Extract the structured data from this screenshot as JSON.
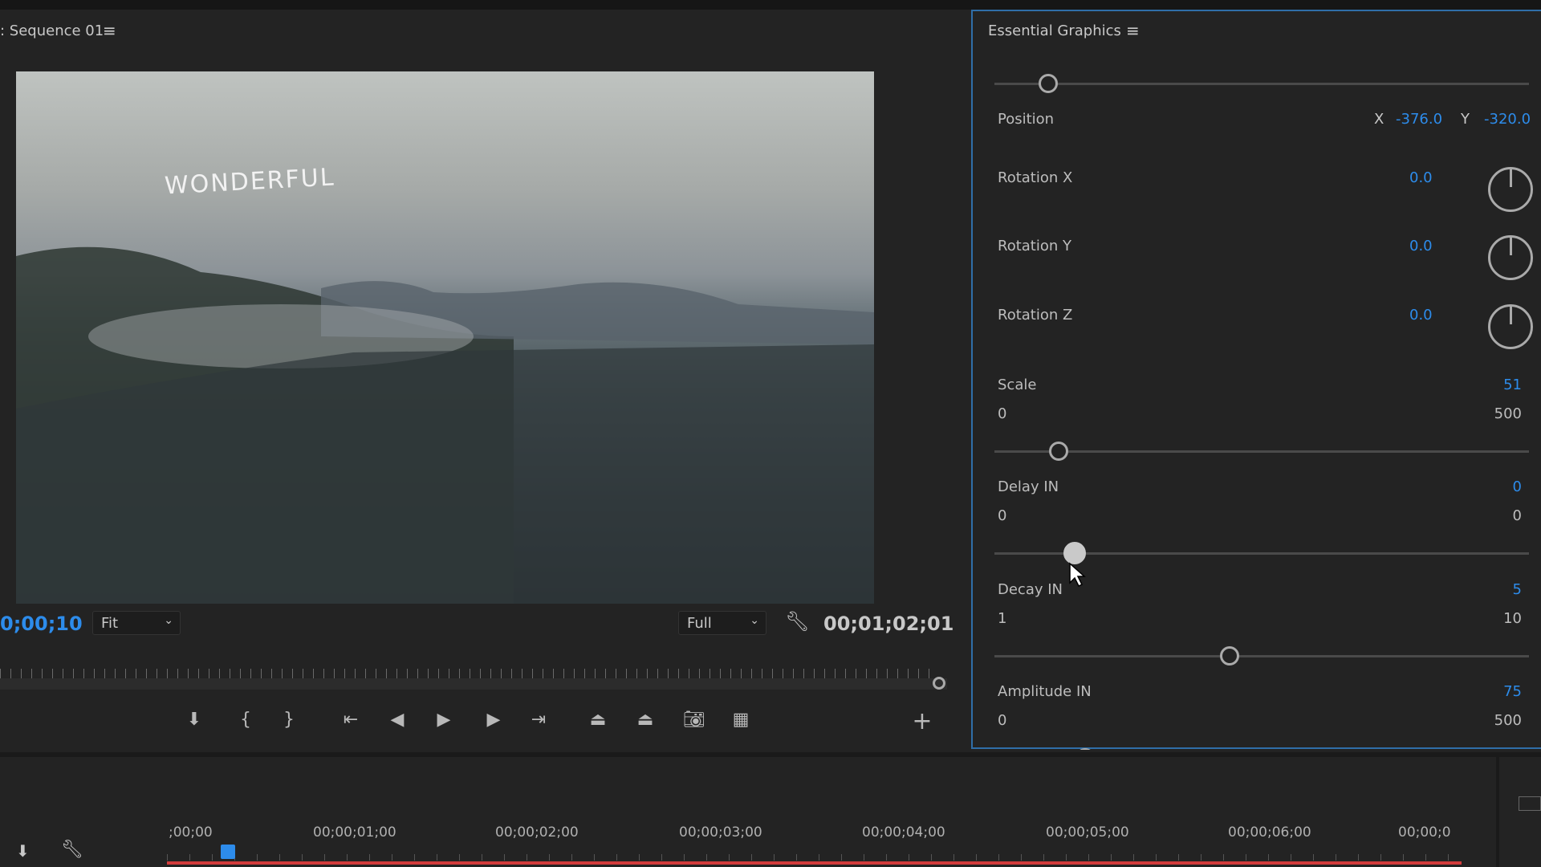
{
  "program": {
    "title": ": Sequence 01",
    "menu_icon": "hamburger-icon",
    "current_timecode": "0;00;10",
    "zoom_select": "Fit",
    "quality_select": "Full",
    "duration": "00;01;02;01",
    "overlay_text": "WONDERFUL"
  },
  "controls": [
    "marker-icon",
    "mark-in-icon",
    "mark-out-icon",
    "go-to-in-icon",
    "step-back-icon",
    "play-icon",
    "step-forward-icon",
    "go-to-out-icon",
    "lift-icon",
    "extract-icon",
    "export-frame-icon",
    "compare-view-icon",
    "add-button-icon"
  ],
  "essential_graphics": {
    "title": "Essential Graphics",
    "top_slider_fraction": 0.1,
    "position": {
      "label": "Position",
      "x_label": "X",
      "x": "-376.0",
      "y_label": "Y",
      "y": "-320.0"
    },
    "rotations": [
      {
        "label": "Rotation X",
        "value": "0.0"
      },
      {
        "label": "Rotation Y",
        "value": "0.0"
      },
      {
        "label": "Rotation Z",
        "value": "0.0"
      }
    ],
    "sliders": [
      {
        "label": "Scale",
        "value": "51",
        "min": "0",
        "max": "500",
        "fraction": 0.12
      },
      {
        "label": "Delay IN",
        "value": "0",
        "min": "0",
        "max": "0",
        "fraction": 0.15,
        "hover": true
      },
      {
        "label": "Decay IN",
        "value": "5",
        "min": "1",
        "max": "10",
        "fraction": 0.44
      },
      {
        "label": "Amplitude IN",
        "value": "75",
        "min": "0",
        "max": "500",
        "fraction": 0.17
      }
    ]
  },
  "timeline": {
    "ticks": [
      ";00;00",
      "00;00;01;00",
      "00;00;02;00",
      "00;00;03;00",
      "00;00;04;00",
      "00;00;05;00",
      "00;00;06;00",
      "00;00;0"
    ]
  },
  "colors": {
    "accent": "#2d8ceb",
    "panel_border": "#2f6ea8",
    "timeline_range": "#d23c3c"
  }
}
